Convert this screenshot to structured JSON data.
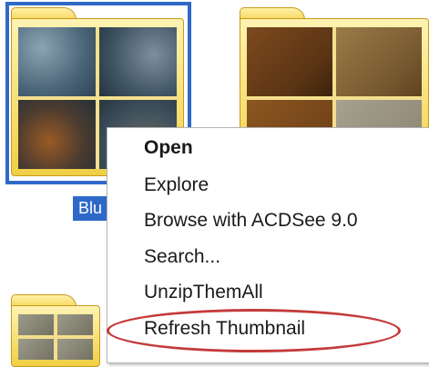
{
  "folders": [
    {
      "label": "Blu",
      "selected": true
    },
    {
      "label": "",
      "selected": false
    },
    {
      "label": "",
      "selected": false
    }
  ],
  "context_menu": {
    "items": [
      {
        "label": "Open",
        "default": true
      },
      {
        "label": "Explore",
        "default": false
      },
      {
        "label": "Browse with ACDSee 9.0",
        "default": false
      },
      {
        "label": "Search...",
        "default": false
      },
      {
        "label": "UnzipThemAll",
        "default": false
      },
      {
        "label": "Refresh Thumbnail",
        "default": false,
        "highlighted": true
      }
    ]
  },
  "colors": {
    "selection": "#2f69c8",
    "highlight_ring": "#c43a3a",
    "folder": "#f0cf45"
  }
}
